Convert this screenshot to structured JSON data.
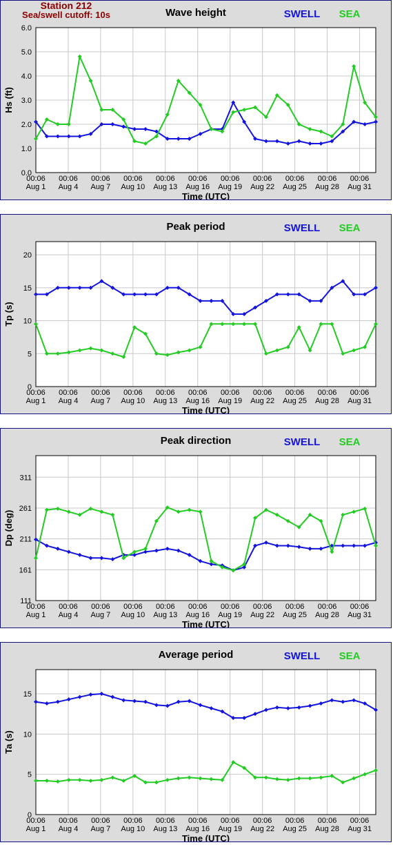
{
  "header": {
    "station": "Station 212",
    "cutoff": "Sea/swell cutoff: 10s"
  },
  "legend": {
    "swell": "SWELL",
    "sea": "SEA"
  },
  "colors": {
    "swell": "#1414e0",
    "sea": "#22cc22",
    "panel_bg": "#dcdcdc",
    "plot_bg": "#ffffff",
    "grid": "#c8c8c8",
    "frame": "#101080",
    "header": "#8b0000"
  },
  "xaxis": {
    "label": "Time (UTC)",
    "ticks": [
      {
        "time": "00:06",
        "date": "Aug 1"
      },
      {
        "time": "00:06",
        "date": "Aug 4"
      },
      {
        "time": "00:06",
        "date": "Aug 7"
      },
      {
        "time": "00:06",
        "date": "Aug 10"
      },
      {
        "time": "00:06",
        "date": "Aug 13"
      },
      {
        "time": "00:06",
        "date": "Aug 16"
      },
      {
        "time": "00:06",
        "date": "Aug 19"
      },
      {
        "time": "00:06",
        "date": "Aug 22"
      },
      {
        "time": "00:06",
        "date": "Aug 25"
      },
      {
        "time": "00:06",
        "date": "Aug 28"
      },
      {
        "time": "00:06",
        "date": "Aug 31"
      }
    ]
  },
  "chart_data": [
    {
      "type": "line",
      "title": "Wave height",
      "ylabel": "Hs (ft)",
      "ylim": [
        0,
        6
      ],
      "yticks": [
        "0.0",
        "1.0",
        "2.0",
        "3.0",
        "4.0",
        "5.0",
        "6.0"
      ],
      "x": [
        "Aug 1",
        "Aug 2",
        "Aug 3",
        "Aug 4",
        "Aug 5",
        "Aug 6",
        "Aug 7",
        "Aug 8",
        "Aug 9",
        "Aug 10",
        "Aug 11",
        "Aug 12",
        "Aug 13",
        "Aug 14",
        "Aug 15",
        "Aug 16",
        "Aug 17",
        "Aug 18",
        "Aug 19",
        "Aug 20",
        "Aug 21",
        "Aug 22",
        "Aug 23",
        "Aug 24",
        "Aug 25",
        "Aug 26",
        "Aug 27",
        "Aug 28",
        "Aug 29",
        "Aug 30",
        "Aug 31",
        "Sep 1"
      ],
      "series": [
        {
          "name": "SWELL",
          "values": [
            2.1,
            1.5,
            1.5,
            1.5,
            1.5,
            1.6,
            2.0,
            2.0,
            1.9,
            1.8,
            1.8,
            1.7,
            1.4,
            1.4,
            1.4,
            1.6,
            1.8,
            1.8,
            2.9,
            2.1,
            1.4,
            1.3,
            1.3,
            1.2,
            1.3,
            1.2,
            1.2,
            1.3,
            1.7,
            2.1,
            2.0,
            2.1
          ]
        },
        {
          "name": "SEA",
          "values": [
            1.4,
            2.2,
            2.0,
            2.0,
            4.8,
            3.8,
            2.6,
            2.6,
            2.2,
            1.3,
            1.2,
            1.5,
            2.4,
            3.8,
            3.3,
            2.8,
            1.8,
            1.7,
            2.5,
            2.6,
            2.7,
            2.3,
            3.2,
            2.8,
            2.0,
            1.8,
            1.7,
            1.5,
            2.0,
            4.4,
            2.9,
            2.3
          ]
        }
      ]
    },
    {
      "type": "line",
      "title": "Peak period",
      "ylabel": "Tp (s)",
      "ylim": [
        0,
        22
      ],
      "yticks": [
        "0",
        "5",
        "10",
        "15",
        "20"
      ],
      "x": [
        "Aug 1",
        "Aug 2",
        "Aug 3",
        "Aug 4",
        "Aug 5",
        "Aug 6",
        "Aug 7",
        "Aug 8",
        "Aug 9",
        "Aug 10",
        "Aug 11",
        "Aug 12",
        "Aug 13",
        "Aug 14",
        "Aug 15",
        "Aug 16",
        "Aug 17",
        "Aug 18",
        "Aug 19",
        "Aug 20",
        "Aug 21",
        "Aug 22",
        "Aug 23",
        "Aug 24",
        "Aug 25",
        "Aug 26",
        "Aug 27",
        "Aug 28",
        "Aug 29",
        "Aug 30",
        "Aug 31",
        "Sep 1"
      ],
      "series": [
        {
          "name": "SWELL",
          "values": [
            14,
            14,
            15,
            15,
            15,
            15,
            16,
            15,
            14,
            14,
            14,
            14,
            15,
            15,
            14,
            13,
            13,
            13,
            11,
            11,
            12,
            13,
            14,
            14,
            14,
            13,
            13,
            15,
            16,
            14,
            14,
            15
          ]
        },
        {
          "name": "SEA",
          "values": [
            9.5,
            5.0,
            5.0,
            5.2,
            5.5,
            5.8,
            5.5,
            5.0,
            4.5,
            9.0,
            8.0,
            5.0,
            4.8,
            5.2,
            5.5,
            6.0,
            9.5,
            9.5,
            9.5,
            9.5,
            9.5,
            5.0,
            5.5,
            6.0,
            9.0,
            5.5,
            9.5,
            9.5,
            5.0,
            5.5,
            6.0,
            9.5
          ]
        }
      ]
    },
    {
      "type": "line",
      "title": "Peak direction",
      "ylabel": "Dp (deg)",
      "ylim": [
        111,
        346
      ],
      "yticks": [
        "111",
        "161",
        "211",
        "261",
        "311"
      ],
      "x": [
        "Aug 1",
        "Aug 2",
        "Aug 3",
        "Aug 4",
        "Aug 5",
        "Aug 6",
        "Aug 7",
        "Aug 8",
        "Aug 9",
        "Aug 10",
        "Aug 11",
        "Aug 12",
        "Aug 13",
        "Aug 14",
        "Aug 15",
        "Aug 16",
        "Aug 17",
        "Aug 18",
        "Aug 19",
        "Aug 20",
        "Aug 21",
        "Aug 22",
        "Aug 23",
        "Aug 24",
        "Aug 25",
        "Aug 26",
        "Aug 27",
        "Aug 28",
        "Aug 29",
        "Aug 30",
        "Aug 31",
        "Sep 1"
      ],
      "series": [
        {
          "name": "SWELL",
          "values": [
            210,
            200,
            195,
            190,
            185,
            180,
            180,
            178,
            185,
            185,
            190,
            192,
            195,
            192,
            185,
            175,
            170,
            168,
            160,
            165,
            200,
            205,
            200,
            200,
            198,
            195,
            195,
            200,
            200,
            200,
            200,
            205
          ]
        },
        {
          "name": "SEA",
          "values": [
            180,
            258,
            260,
            255,
            250,
            260,
            255,
            250,
            180,
            190,
            195,
            240,
            262,
            255,
            258,
            255,
            175,
            165,
            160,
            170,
            245,
            258,
            250,
            240,
            230,
            250,
            240,
            190,
            250,
            255,
            260,
            200
          ]
        }
      ]
    },
    {
      "type": "line",
      "title": "Average period",
      "ylabel": "Ta (s)",
      "ylim": [
        0,
        18
      ],
      "yticks": [
        "0",
        "5",
        "10",
        "15"
      ],
      "x": [
        "Aug 1",
        "Aug 2",
        "Aug 3",
        "Aug 4",
        "Aug 5",
        "Aug 6",
        "Aug 7",
        "Aug 8",
        "Aug 9",
        "Aug 10",
        "Aug 11",
        "Aug 12",
        "Aug 13",
        "Aug 14",
        "Aug 15",
        "Aug 16",
        "Aug 17",
        "Aug 18",
        "Aug 19",
        "Aug 20",
        "Aug 21",
        "Aug 22",
        "Aug 23",
        "Aug 24",
        "Aug 25",
        "Aug 26",
        "Aug 27",
        "Aug 28",
        "Aug 29",
        "Aug 30",
        "Aug 31",
        "Sep 1"
      ],
      "series": [
        {
          "name": "SWELL",
          "values": [
            14.0,
            13.8,
            14.0,
            14.3,
            14.6,
            14.9,
            15.0,
            14.6,
            14.2,
            14.1,
            14.0,
            13.6,
            13.5,
            14.0,
            14.1,
            13.6,
            13.2,
            12.8,
            12.0,
            12.0,
            12.5,
            13.0,
            13.3,
            13.2,
            13.3,
            13.5,
            13.8,
            14.2,
            14.0,
            14.2,
            13.8,
            13.0
          ]
        },
        {
          "name": "SEA",
          "values": [
            4.2,
            4.2,
            4.1,
            4.3,
            4.3,
            4.2,
            4.3,
            4.6,
            4.2,
            4.8,
            4.0,
            4.0,
            4.3,
            4.5,
            4.6,
            4.5,
            4.4,
            4.3,
            6.5,
            5.8,
            4.6,
            4.6,
            4.4,
            4.3,
            4.5,
            4.5,
            4.6,
            4.8,
            4.0,
            4.5,
            5.0,
            5.5
          ]
        }
      ]
    }
  ]
}
